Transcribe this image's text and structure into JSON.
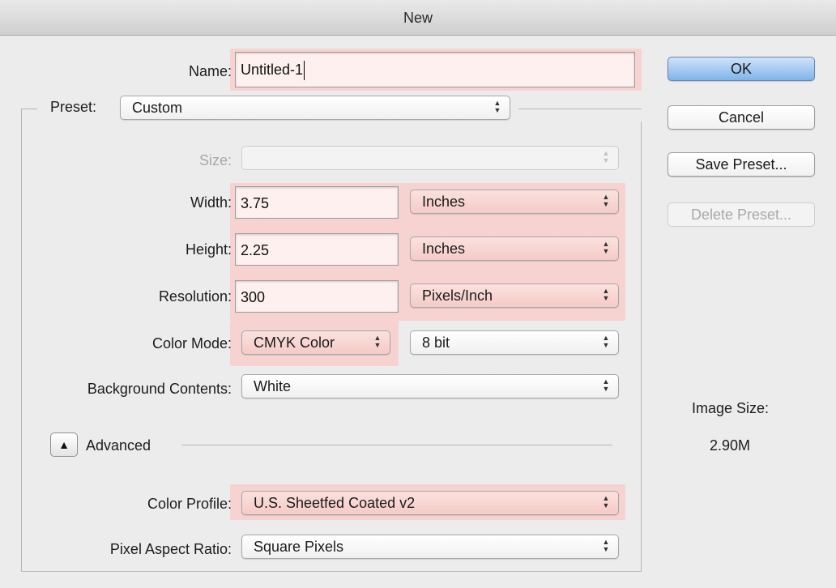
{
  "window": {
    "title": "New"
  },
  "name": {
    "label": "Name:",
    "value": "Untitled-1"
  },
  "preset": {
    "label": "Preset:",
    "value": "Custom"
  },
  "size": {
    "label": "Size:",
    "value": ""
  },
  "width": {
    "label": "Width:",
    "value": "3.75",
    "unit": "Inches"
  },
  "height": {
    "label": "Height:",
    "value": "2.25",
    "unit": "Inches"
  },
  "resolution": {
    "label": "Resolution:",
    "value": "300",
    "unit": "Pixels/Inch"
  },
  "color_mode": {
    "label": "Color Mode:",
    "value": "CMYK Color",
    "bits": "8 bit"
  },
  "background": {
    "label": "Background Contents:",
    "value": "White"
  },
  "advanced": {
    "label": "Advanced",
    "toggle_icon": "triangle-up-icon"
  },
  "color_profile": {
    "label": "Color Profile:",
    "value": "U.S. Sheetfed Coated v2"
  },
  "pixel_aspect": {
    "label": "Pixel Aspect Ratio:",
    "value": "Square Pixels"
  },
  "buttons": {
    "ok": "OK",
    "cancel": "Cancel",
    "save_preset": "Save Preset...",
    "delete_preset": "Delete Preset..."
  },
  "image_size": {
    "label": "Image Size:",
    "value": "2.90M"
  },
  "colors": {
    "highlight": "#f6d3d0",
    "ok_button": "#7fb4ea",
    "background": "#ececec"
  }
}
